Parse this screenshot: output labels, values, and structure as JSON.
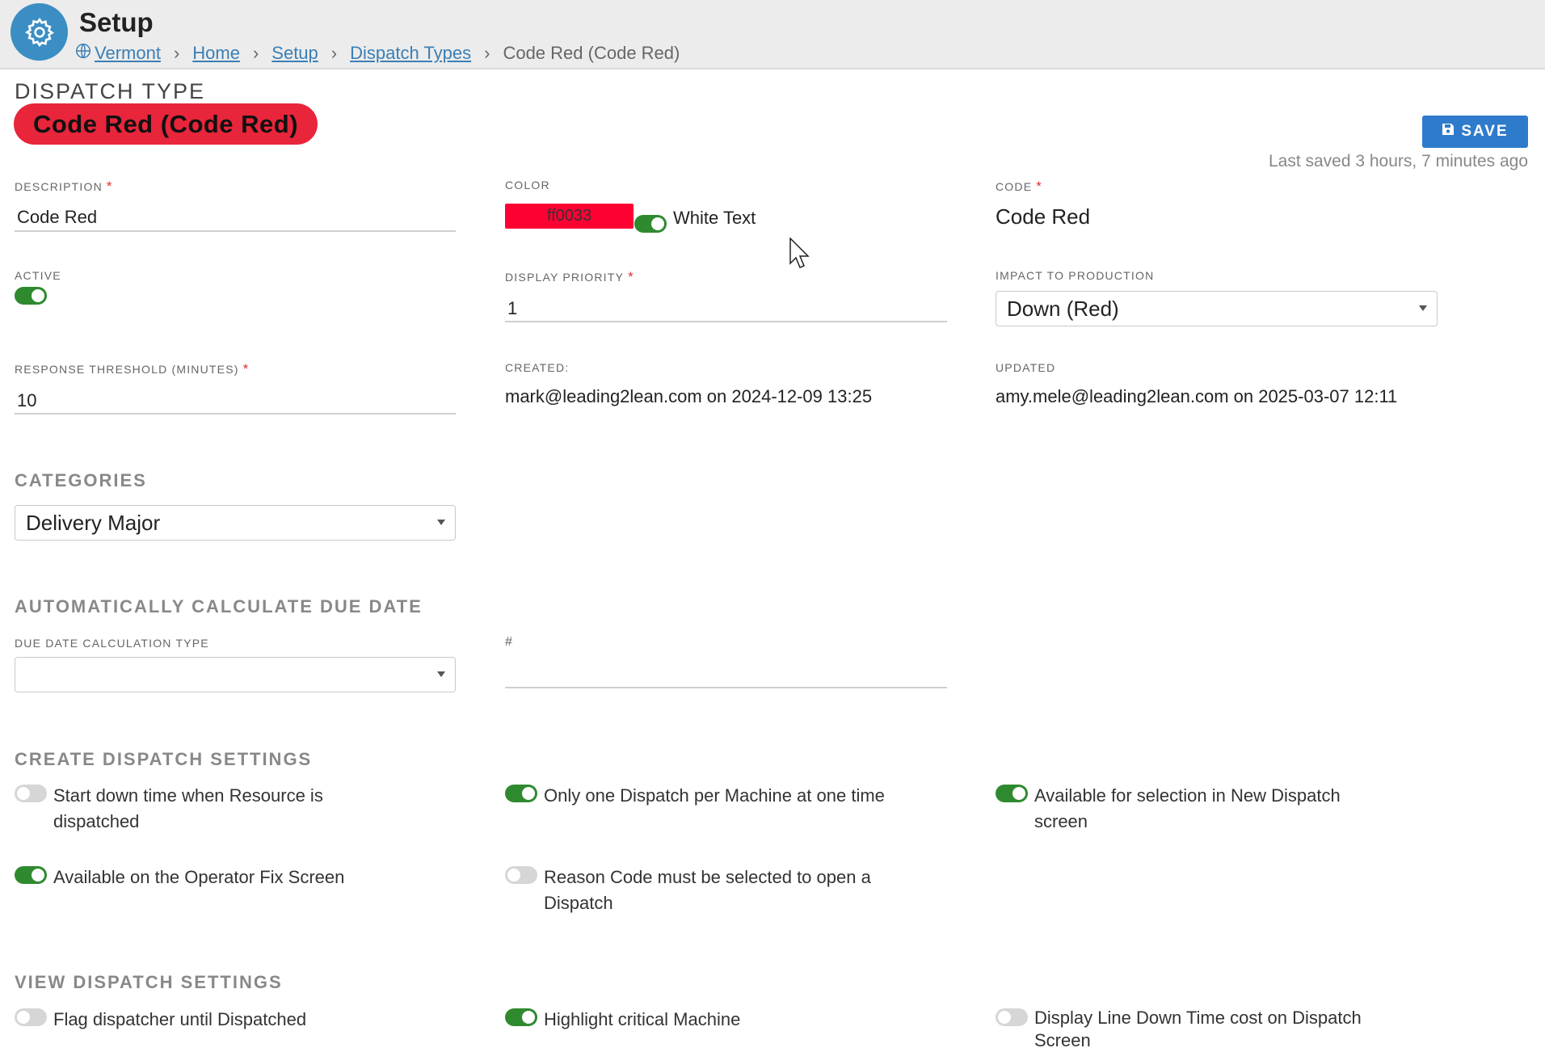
{
  "header": {
    "title": "Setup",
    "breadcrumbs": [
      "Vermont",
      "Home",
      "Setup",
      "Dispatch Types"
    ],
    "current": "Code Red (Code Red)"
  },
  "page": {
    "section_label": "DISPATCH TYPE",
    "pill_text": "Code Red (Code Red)",
    "save_label": "SAVE",
    "last_saved": "Last saved 3 hours, 7 minutes ago"
  },
  "fields": {
    "description": {
      "label": "Description",
      "value": "Code Red"
    },
    "color": {
      "label": "Color",
      "value": "ff0033",
      "white_text_label": "White Text",
      "white_text_on": true
    },
    "code": {
      "label": "Code",
      "value": "Code Red"
    },
    "active": {
      "label": "Active",
      "on": true
    },
    "display_priority": {
      "label": "Display Priority",
      "value": "1"
    },
    "impact": {
      "label": "Impact to Production",
      "value": "Down (Red)"
    },
    "response_threshold": {
      "label": "Response Threshold (minutes)",
      "value": "10"
    },
    "created": {
      "label": "Created:",
      "value": "mark@leading2lean.com on 2024-12-09 13:25"
    },
    "updated": {
      "label": "Updated",
      "value": "amy.mele@leading2lean.com on 2025-03-07 12:11"
    }
  },
  "categories": {
    "heading": "Categories",
    "value": "Delivery Major"
  },
  "due_date": {
    "heading": "Automatically Calculate Due Date",
    "type_label": "Due Date Calculation Type",
    "type_value": "",
    "number_label": "#"
  },
  "create_settings": {
    "heading": "Create Dispatch Settings",
    "options": [
      {
        "line1": "Start down time when Resource is",
        "line2": "dispatched",
        "on": false
      },
      {
        "line1": "Only one Dispatch per Machine at one time",
        "line2": "",
        "on": true
      },
      {
        "line1": "Available for selection in New Dispatch",
        "line2": "screen",
        "on": true
      },
      {
        "line1": "Available on the Operator Fix Screen",
        "line2": "",
        "on": true
      },
      {
        "line1": "Reason Code must be selected to open a",
        "line2": "Dispatch",
        "on": false
      }
    ]
  },
  "view_settings": {
    "heading": "View Dispatch Settings",
    "options": [
      {
        "line1": "Flag dispatcher until Dispatched",
        "line2": "",
        "on": false
      },
      {
        "line1": "Highlight critical Machine",
        "line2": "",
        "on": true
      },
      {
        "line1": "Display Line Down Time cost on Dispatch",
        "line2": "Screen",
        "on": false
      }
    ]
  },
  "colors": {
    "accent": "#2f7bcb",
    "toggle_on": "#2f8a2f",
    "code_red": "#ff0033"
  }
}
